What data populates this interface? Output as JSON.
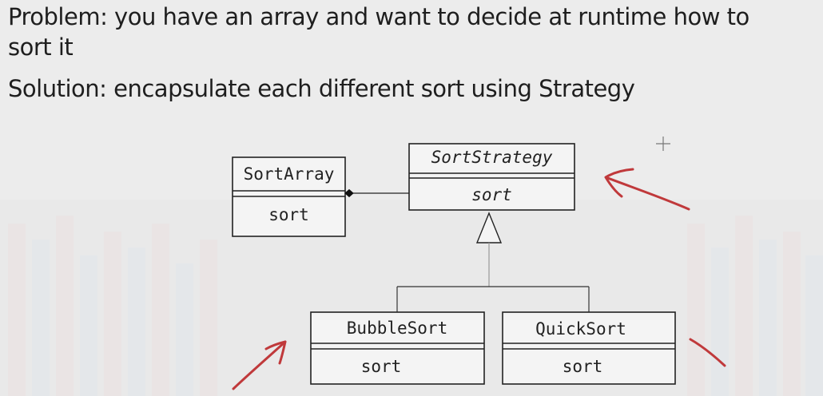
{
  "text": {
    "problem_line1": "Problem: you have an array and want to decide at runtime how to",
    "problem_line2": "sort it",
    "solution": "Solution: encapsulate each different sort using Strategy"
  },
  "uml": {
    "sort_array": {
      "name": "SortArray",
      "operation": "sort"
    },
    "sort_strategy": {
      "name": "SortStrategy",
      "operation": "sort"
    },
    "bubble_sort": {
      "name": "BubbleSort",
      "operation": "sort"
    },
    "quick_sort": {
      "name": "QuickSort",
      "operation": "sort"
    }
  },
  "colors": {
    "background": "#ececec",
    "text": "#1e1e1e",
    "uml_line": "#222222",
    "annotation": "#c0393b"
  }
}
